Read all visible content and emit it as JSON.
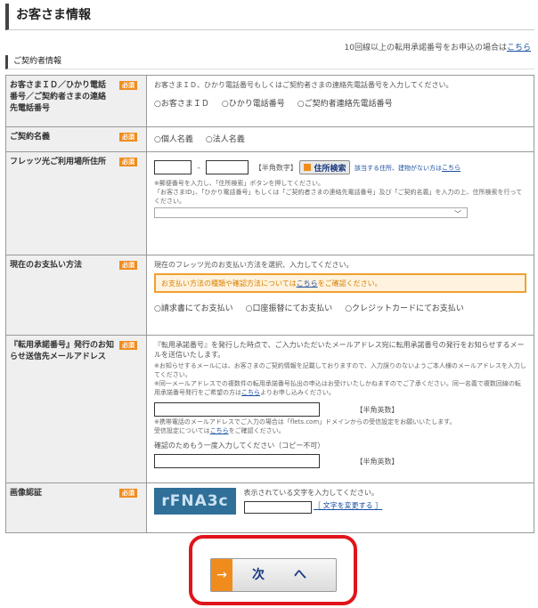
{
  "page": {
    "title": "お客さま情報"
  },
  "top_note": {
    "text": "10回線以上の転用承諾番号をお申込の場合は",
    "link": "こちら"
  },
  "section": {
    "label": "ご契約者情報"
  },
  "required_label": "必須",
  "rows": {
    "contract_id": {
      "label": "お客さまＩＤ／ひかり電話番号／ご契約者さまの連絡先電話番号",
      "desc": "お客さまＩＤ、ひかり電話番号もしくはご契約者さまの連絡先電話番号を入力してください。",
      "options": [
        "○お客さまＩＤ",
        "○ひかり電話番号",
        "○ご契約者連絡先電話番号"
      ]
    },
    "contract_name": {
      "label": "ご契約名義",
      "options": [
        "○個人名義",
        "○法人名義"
      ]
    },
    "address": {
      "label": "フレッツ光ご利用場所住所",
      "hyphen": "-",
      "half_width": "【半角数字】",
      "search_button": "住所検索",
      "no_match_prefix": "該当する住所、建物がない方は",
      "no_match_link": "こちら",
      "note1": "※郵便番号を入力し、「住所検索」ボタンを押してください。",
      "note2": "「お客さまID」、「ひかり電話番号」もしくは「ご契約者さまの連絡先電話番号」及び「ご契約名義」を入力の上、住所検索を行ってください。"
    },
    "payment": {
      "label": "現在のお支払い方法",
      "desc": "現在のフレッツ光のお支払い方法を選択、入力してください。",
      "notice_prefix": "お支払い方法の種類や確認方法については",
      "notice_link": "こちら",
      "notice_suffix": "をご確認ください。",
      "options": [
        "○請求書にてお支払い",
        "○口座振替にてお支払い",
        "○クレジットカードにてお支払い"
      ]
    },
    "email": {
      "label": "『転用承諾番号』発行のお知らせ送信先メールアドレス",
      "desc": "『転用承諾番号』を発行した時点で、ご入力いただいたメールアドレス宛に転用承諾番号の発行をお知らせするメールを送信いたします。",
      "note1": "※お知らせするメールには、お客さまのご契約情報を記載しておりますので、入力誤りのないようご本人様のメールアドレスを入力してください。",
      "note2_prefix": "※同一メールアドレスでの複数件の転用承諾番号払出の申込はお受けいたしかねますのでご了承ください。同一名義で複数回線の転用承諾番号発行をご希望の方は",
      "note2_link": "こちら",
      "note2_suffix": "よりお申し込みください。",
      "half_width": "【半角英数】",
      "note3": "※携帯電話のメールアドレスでご入力の場合は「flets.com」ドメインからの受信設定をお願いいたします。",
      "note4_prefix": "受信設定については",
      "note4_link": "こちら",
      "note4_suffix": "をご確認ください。",
      "confirm_label": "確認のためもう一度入力してください（コピー不可）",
      "confirm_half_width": "【半角英数】"
    },
    "captcha": {
      "label": "画像認証",
      "image_text": "rFNA3c",
      "desc": "表示されている文字を入力してください。",
      "change_link": "［ 文字を変更する ］"
    }
  },
  "next_button": {
    "label": "次 へ",
    "arrow": "→"
  },
  "colors": {
    "required": "#f08c1e",
    "link": "#1a4fa0",
    "highlight": "#e0141b",
    "captcha_bg": "#2f6f98"
  }
}
